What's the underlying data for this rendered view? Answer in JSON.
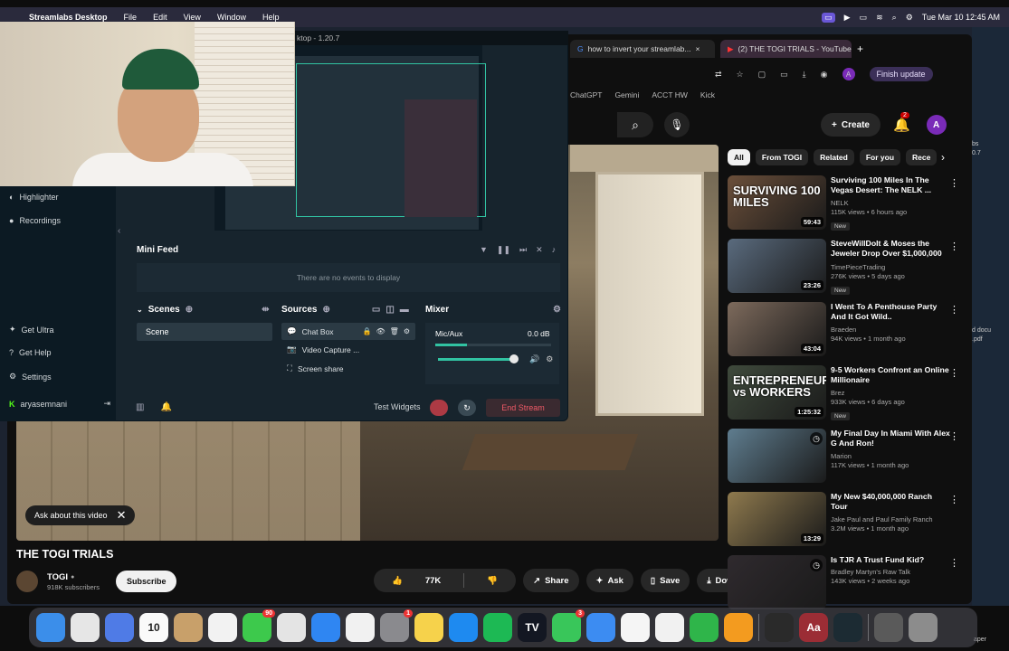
{
  "menubar": {
    "app_name": "Streamlabs Desktop",
    "menus": [
      "File",
      "Edit",
      "View",
      "Window",
      "Help"
    ],
    "datetime": "Tue Mar 10  12:45 AM"
  },
  "browser": {
    "tabs": [
      {
        "label": "how to invert your streamlab..."
      },
      {
        "label": "(2) THE TOGI TRIALS - YouTube"
      }
    ],
    "new_tab": "+",
    "finish_update": "Finish update",
    "profile_initial": "A",
    "bookmarks": [
      "ChatGPT",
      "Gemini",
      "ACCT HW",
      "Kick"
    ]
  },
  "youtube": {
    "create_label": "Create",
    "notif_count": "2",
    "avatar_initial": "A",
    "video": {
      "title": "THE TOGI TRIALS",
      "ask_about": "Ask about this video",
      "channel_name": "TOGI",
      "subscribers": "918K subscribers",
      "subscribe": "Subscribe",
      "likes": "77K",
      "share": "Share",
      "ask": "Ask",
      "save": "Save",
      "download": "Download"
    },
    "chips": [
      "All",
      "From TOGI",
      "Related",
      "For you",
      "Rece"
    ],
    "recommendations": [
      {
        "title": "Surviving 100 Miles In The Vegas Desert: The NELK ...",
        "channel": "NELK",
        "views": "115K views • 6 hours ago",
        "duration": "59:43",
        "is_new": true,
        "new_label": "New",
        "thumb_text": "SURVIVING 100 MILES",
        "thumb_color": "#6b4f3a"
      },
      {
        "title": "SteveWillDoIt & Moses the Jeweler Drop Over $1,000,000 ...",
        "channel": "TimePieceTrading",
        "views": "276K views • 5 days ago",
        "duration": "23:26",
        "is_new": true,
        "new_label": "New",
        "thumb_text": "",
        "thumb_color": "#5a6b7e"
      },
      {
        "title": "I Went To A Penthouse Party And It Got Wild..",
        "channel": "Braeden",
        "views": "94K views • 1 month ago",
        "duration": "43:04",
        "is_new": false,
        "thumb_text": "",
        "thumb_color": "#7d6a5c"
      },
      {
        "title": "9-5 Workers Confront an Online Millionaire",
        "channel": "Brez",
        "views": "933K views • 6 days ago",
        "duration": "1:25:32",
        "is_new": true,
        "new_label": "New",
        "thumb_text": "ENTREPRENEUR vs WORKERS",
        "thumb_color": "#3f4a3c"
      },
      {
        "title": "My Final Day In Miami With Alex G And Ron!",
        "channel": "Marion",
        "views": "117K views • 1 month ago",
        "duration": "",
        "is_new": false,
        "thumb_text": "",
        "thumb_color": "#5f7d8f"
      },
      {
        "title": "My New $40,000,000 Ranch Tour",
        "channel": "Jake Paul and Paul Family Ranch",
        "views": "3.2M views • 1 month ago",
        "duration": "13:29",
        "is_new": false,
        "thumb_text": "",
        "thumb_color": "#8f7a4e"
      },
      {
        "title": "Is TJR A Trust Fund Kid?",
        "channel": "Bradley Martyn's Raw Talk",
        "views": "143K views • 2 weeks ago",
        "duration": "",
        "is_new": false,
        "thumb_text": "",
        "thumb_color": "#2f2a2e"
      }
    ]
  },
  "streamlabs": {
    "title": "ktop - 1.20.7",
    "nav": [
      {
        "label": "Highlighter"
      },
      {
        "label": "Recordings"
      },
      {
        "label": "Get Ultra"
      },
      {
        "label": "Get Help"
      },
      {
        "label": "Settings"
      },
      {
        "label": "aryasemnani"
      }
    ],
    "minifeed_title": "Mini Feed",
    "minifeed_empty": "There are no events to display",
    "scenes_label": "Scenes",
    "scene_item": "Scene",
    "sources_label": "Sources",
    "sources": [
      "Chat Box",
      "Video Capture ...",
      "Screen share"
    ],
    "mixer_label": "Mixer",
    "mixer_channel": "Mic/Aux",
    "mixer_db": "0.0 dB",
    "mixer_level": 0.27,
    "test_widgets": "Test Widgets",
    "end_stream": "End Stream"
  },
  "dock": {
    "apps": [
      {
        "name": "finder",
        "color": "#3b8eea",
        "glyph": ""
      },
      {
        "name": "launchpad",
        "color": "#e6e6e6",
        "glyph": ""
      },
      {
        "name": "control-center",
        "color": "#4f7be6",
        "glyph": ""
      },
      {
        "name": "calendar",
        "color": "#fafafa",
        "glyph": "10",
        "badge": ""
      },
      {
        "name": "contacts",
        "color": "#c8a06a",
        "glyph": ""
      },
      {
        "name": "reminders",
        "color": "#f2f2f2",
        "glyph": ""
      },
      {
        "name": "messages",
        "color": "#3dc94c",
        "glyph": "",
        "badge": "90"
      },
      {
        "name": "chrome",
        "color": "#e4e4e4",
        "glyph": ""
      },
      {
        "name": "safari",
        "color": "#2f86f2",
        "glyph": ""
      },
      {
        "name": "photos",
        "color": "#f1f1f1",
        "glyph": ""
      },
      {
        "name": "system-settings",
        "color": "#8a8a8e",
        "glyph": "",
        "badge": "1"
      },
      {
        "name": "notes",
        "color": "#f6d24b",
        "glyph": ""
      },
      {
        "name": "app-store",
        "color": "#1e8af0",
        "glyph": ""
      },
      {
        "name": "spotify",
        "color": "#1db954",
        "glyph": ""
      },
      {
        "name": "tradingview",
        "color": "#131722",
        "glyph": "TV"
      },
      {
        "name": "facetime",
        "color": "#39c65a",
        "glyph": "",
        "badge": "3"
      },
      {
        "name": "mail",
        "color": "#3c8cf2",
        "glyph": ""
      },
      {
        "name": "freeform",
        "color": "#f5f5f5",
        "glyph": ""
      },
      {
        "name": "news",
        "color": "#f1f1f1",
        "glyph": ""
      },
      {
        "name": "numbers",
        "color": "#2fb54a",
        "glyph": ""
      },
      {
        "name": "pages",
        "color": "#f39b1f",
        "glyph": ""
      },
      {
        "name": "streamlabs",
        "color": "#2a2a2a",
        "glyph": ""
      },
      {
        "name": "dictionary",
        "color": "#9b2d35",
        "glyph": "Aa"
      },
      {
        "name": "streamlabs-obs",
        "color": "#1c2b33",
        "glyph": ""
      },
      {
        "name": "folder",
        "color": "#5a5a5a",
        "glyph": ""
      },
      {
        "name": "trash",
        "color": "#8c8c8c",
        "glyph": ""
      }
    ]
  },
  "desktop_edge": {
    "files": [
      "bs",
      "0.7",
      "d docu",
      ".pdf",
      "aper"
    ]
  }
}
